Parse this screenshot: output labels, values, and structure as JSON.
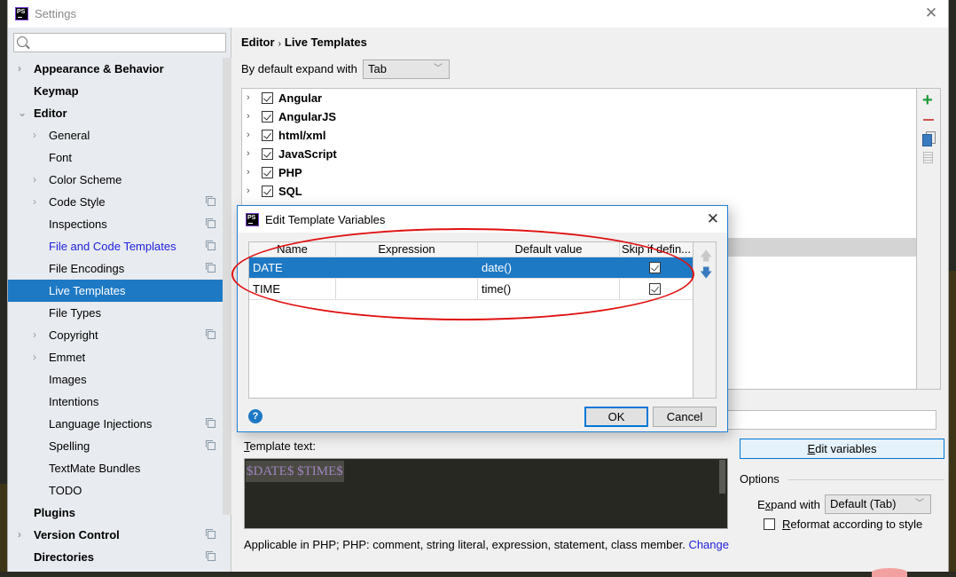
{
  "window": {
    "title": "Settings",
    "app_icon": "phpstorm-logo",
    "close_icon": "close-icon"
  },
  "sidebar": {
    "search_placeholder": "",
    "items": [
      {
        "label": "Appearance & Behavior",
        "level": 0,
        "bold": true,
        "arrow": "›"
      },
      {
        "label": "Keymap",
        "level": 0,
        "bold": true,
        "arrow": ""
      },
      {
        "label": "Editor",
        "level": 0,
        "bold": true,
        "arrow": "⌄"
      },
      {
        "label": "General",
        "level": 1,
        "arrow": "›"
      },
      {
        "label": "Font",
        "level": 1,
        "arrow": ""
      },
      {
        "label": "Color Scheme",
        "level": 1,
        "arrow": "›"
      },
      {
        "label": "Code Style",
        "level": 1,
        "arrow": "›",
        "project": true
      },
      {
        "label": "Inspections",
        "level": 1,
        "arrow": "",
        "project": true
      },
      {
        "label": "File and Code Templates",
        "level": 1,
        "arrow": "",
        "project": true,
        "link": true
      },
      {
        "label": "File Encodings",
        "level": 1,
        "arrow": "",
        "project": true
      },
      {
        "label": "Live Templates",
        "level": 1,
        "arrow": "",
        "selected": true
      },
      {
        "label": "File Types",
        "level": 1,
        "arrow": ""
      },
      {
        "label": "Copyright",
        "level": 1,
        "arrow": "›",
        "project": true
      },
      {
        "label": "Emmet",
        "level": 1,
        "arrow": "›"
      },
      {
        "label": "Images",
        "level": 1,
        "arrow": ""
      },
      {
        "label": "Intentions",
        "level": 1,
        "arrow": ""
      },
      {
        "label": "Language Injections",
        "level": 1,
        "arrow": "",
        "project": true
      },
      {
        "label": "Spelling",
        "level": 1,
        "arrow": "",
        "project": true
      },
      {
        "label": "TextMate Bundles",
        "level": 1,
        "arrow": ""
      },
      {
        "label": "TODO",
        "level": 1,
        "arrow": ""
      },
      {
        "label": "Plugins",
        "level": 0,
        "bold": true,
        "arrow": ""
      },
      {
        "label": "Version Control",
        "level": 0,
        "bold": true,
        "arrow": "›",
        "project": true
      },
      {
        "label": "Directories",
        "level": 0,
        "bold": true,
        "arrow": "",
        "project": true
      }
    ]
  },
  "main": {
    "breadcrumb": {
      "parent": "Editor",
      "separator": "›",
      "current": "Live Templates"
    },
    "expand_label": "By default expand with",
    "expand_value": "Tab",
    "template_groups": [
      {
        "name": "Angular",
        "checked": true
      },
      {
        "name": "AngularJS",
        "checked": true
      },
      {
        "name": "html/xml",
        "checked": true
      },
      {
        "name": "JavaScript",
        "checked": true
      },
      {
        "name": "PHP",
        "checked": true
      },
      {
        "name": "SQL",
        "checked": true
      }
    ],
    "tools": {
      "add": "+",
      "remove": "−"
    },
    "template_text_label_mnemonic": "T",
    "template_text_label_rest": "emplate text:",
    "template_text": "$DATE$ $TIME$",
    "applicable_text": "Applicable in PHP; PHP: comment, string literal, expression, statement, class member.",
    "change_link": "Change",
    "edit_variables_mnemonic": "E",
    "edit_variables_rest": "dit variables",
    "options_label": "Options",
    "expand_with_pre": "E",
    "expand_with_mnemonic": "x",
    "expand_with_post": "pand with",
    "expand_with_value": "Default (Tab)",
    "reformat_mnemonic": "R",
    "reformat_rest": "eformat according to style",
    "reformat_checked": false
  },
  "dialog": {
    "title": "Edit Template Variables",
    "columns": [
      "Name",
      "Expression",
      "Default value",
      "Skip if defin..."
    ],
    "rows": [
      {
        "name": "DATE",
        "expression": "",
        "default_value": "date()",
        "skip_if_defined": true,
        "selected": true
      },
      {
        "name": "TIME",
        "expression": "",
        "default_value": "time()",
        "skip_if_defined": true,
        "selected": false
      }
    ],
    "move_up": "🡅",
    "move_down": "🡇",
    "help": "?",
    "ok_label": "OK",
    "cancel_label": "Cancel"
  },
  "colors": {
    "selection": "#1e79c4",
    "link": "#2222dd",
    "annotation": "#e01010",
    "add": "#1f9b3a",
    "remove": "#d0534c"
  }
}
